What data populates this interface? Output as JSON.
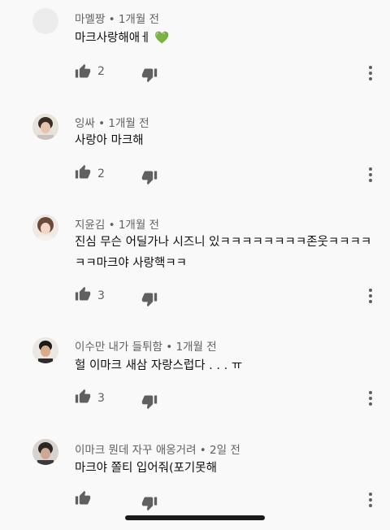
{
  "comments": [
    {
      "author": "마멜짱",
      "time": "• 1개월 전",
      "text": "마크사랑해애ㅔ 💚",
      "likes": "2"
    },
    {
      "author": "잉싸",
      "time": "• 1개월 전",
      "text": "사랑아 마크해",
      "likes": "2"
    },
    {
      "author": "지윤김",
      "time": "• 1개월 전",
      "text": "진심 무슨 어딜가나 시즈니 있ㅋㅋㅋㅋㅋㅋㅋㅋ존웃ㅋㅋㅋㅋㅋㅋ마크야 사랑핵ㅋㅋ",
      "likes": "3"
    },
    {
      "author": "이수만 내가 들튀함",
      "time": "• 1개월 전",
      "text": "헐 이마크 새삼 자랑스럽다 . . . ㅠ",
      "likes": "3"
    },
    {
      "author": "이마크 뭔데 자꾸 애옹거려",
      "time": "• 2일 전",
      "text": "마크야 쫄티 입어줘(포기못해",
      "likes": ""
    }
  ],
  "icons": {
    "like": "thumb-up-icon",
    "dislike": "thumb-down-icon",
    "more": "more-vert-icon"
  },
  "colors": {
    "background": "#f9f9f9",
    "secondary_text": "#606060",
    "primary_text": "#0f0f0f"
  }
}
